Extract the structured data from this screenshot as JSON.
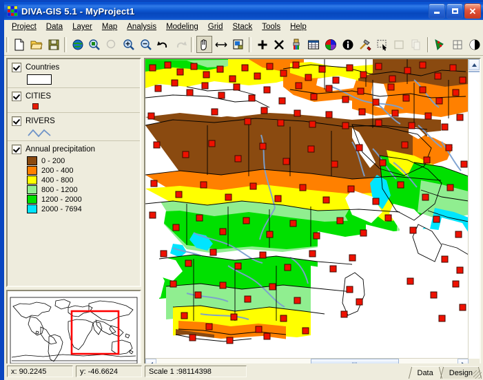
{
  "window": {
    "title": "DIVA-GIS 5.1 - MyProject1",
    "app_icon": "diva-gis-logo-icon",
    "minimize_label": "Minimize",
    "maximize_label": "Maximize",
    "close_label": "Close"
  },
  "menu": {
    "items": [
      {
        "label": "Project",
        "accel": "P"
      },
      {
        "label": "Data",
        "accel": "D"
      },
      {
        "label": "Layer",
        "accel": "L"
      },
      {
        "label": "Map",
        "accel": "M"
      },
      {
        "label": "Analysis",
        "accel": "A"
      },
      {
        "label": "Modeling",
        "accel": "o"
      },
      {
        "label": "Grid",
        "accel": "G"
      },
      {
        "label": "Stack",
        "accel": "S"
      },
      {
        "label": "Tools",
        "accel": "T"
      },
      {
        "label": "Help",
        "accel": "H"
      }
    ]
  },
  "toolbar": {
    "buttons": [
      {
        "name": "new-project-icon",
        "tip": "New Project"
      },
      {
        "name": "open-project-icon",
        "tip": "Open Project"
      },
      {
        "name": "save-project-icon",
        "tip": "Save Project"
      },
      {
        "name": "zoom-full-extent-globe-icon",
        "tip": "Zoom to Full Extent"
      },
      {
        "name": "zoom-to-layer-icon",
        "tip": "Zoom to Layer"
      },
      {
        "name": "zoom-previous-icon",
        "tip": "Zoom Previous",
        "disabled": true
      },
      {
        "name": "zoom-in-icon",
        "tip": "Zoom In"
      },
      {
        "name": "zoom-out-icon",
        "tip": "Zoom Out"
      },
      {
        "name": "undo-zoom-icon",
        "tip": "Undo Zoom"
      },
      {
        "name": "redo-zoom-icon",
        "tip": "Redo Zoom",
        "disabled": true
      },
      {
        "name": "pan-hand-icon",
        "tip": "Pan",
        "pressed": true
      },
      {
        "name": "measure-distance-icon",
        "tip": "Measure Distance"
      },
      {
        "name": "select-by-box-icon",
        "tip": "Select Features"
      },
      {
        "name": "add-layer-icon",
        "tip": "Add Layer"
      },
      {
        "name": "remove-layer-icon",
        "tip": "Remove Layer"
      },
      {
        "name": "layer-properties-paint-icon",
        "tip": "Layer Properties"
      },
      {
        "name": "open-table-icon",
        "tip": "Open Table"
      },
      {
        "name": "legend-colors-icon",
        "tip": "Legend"
      },
      {
        "name": "identify-info-icon",
        "tip": "Identify"
      },
      {
        "name": "tools-hammer-icon",
        "tip": "Tools"
      },
      {
        "name": "select-rectangle-icon",
        "tip": "Select by Rectangle"
      },
      {
        "name": "clear-selection-icon",
        "tip": "Clear Selection",
        "disabled": true
      },
      {
        "name": "copy-records-icon",
        "tip": "Copy",
        "disabled": true
      },
      {
        "name": "point-to-grid-icon",
        "tip": "Point to Grid"
      },
      {
        "name": "grid-icon",
        "tip": "Grid"
      },
      {
        "name": "globe-partial-icon",
        "tip": "Globe"
      }
    ]
  },
  "legend_panel": {
    "layers": [
      {
        "name": "Countries",
        "checked": true,
        "symbol": "polygon-outline",
        "fill": "#ffffff",
        "stroke": "#000000"
      },
      {
        "name": "CITIES",
        "checked": true,
        "symbol": "point-square",
        "fill": "#e81c00",
        "stroke": "#4a0f00"
      },
      {
        "name": "RIVERS",
        "checked": true,
        "symbol": "line-zigzag",
        "stroke": "#6f94c8"
      },
      {
        "name": "Annual precipitation",
        "checked": true,
        "symbol": "graduated-classes",
        "classes": [
          {
            "label": "0 - 200",
            "color": "#8a4a10"
          },
          {
            "label": "200 - 400",
            "color": "#ff8000"
          },
          {
            "label": "400 - 800",
            "color": "#ffff00"
          },
          {
            "label": "800 - 1200",
            "color": "#90ee90"
          },
          {
            "label": "1200 - 2000",
            "color": "#00e000"
          },
          {
            "label": "2000 - 7694",
            "color": "#00e5ff"
          }
        ]
      }
    ]
  },
  "overview_map": {
    "name": "world-overview-map",
    "extent_rect_color": "#ff0000",
    "land_stroke": "#000000",
    "background": "#ffffff"
  },
  "map_view": {
    "name": "main-map-canvas",
    "background": "#ffffff",
    "city_marker_fill": "#ee1100",
    "city_marker_stroke": "#3a0a00",
    "border_stroke": "#000000",
    "river_stroke": "#7ba0d0"
  },
  "scrollbars": {
    "vertical": {
      "up_arrow": "▲",
      "down_arrow": "▼"
    },
    "horizontal": {
      "left_arrow": "◄",
      "right_arrow": "►"
    }
  },
  "status_bar": {
    "x_label": "x: 90.2245",
    "y_label": "y: -46.6624",
    "scale_label": "Scale 1 :98114398"
  },
  "tabs": [
    {
      "label": "Data",
      "active": true
    },
    {
      "label": "Design",
      "active": false
    }
  ]
}
